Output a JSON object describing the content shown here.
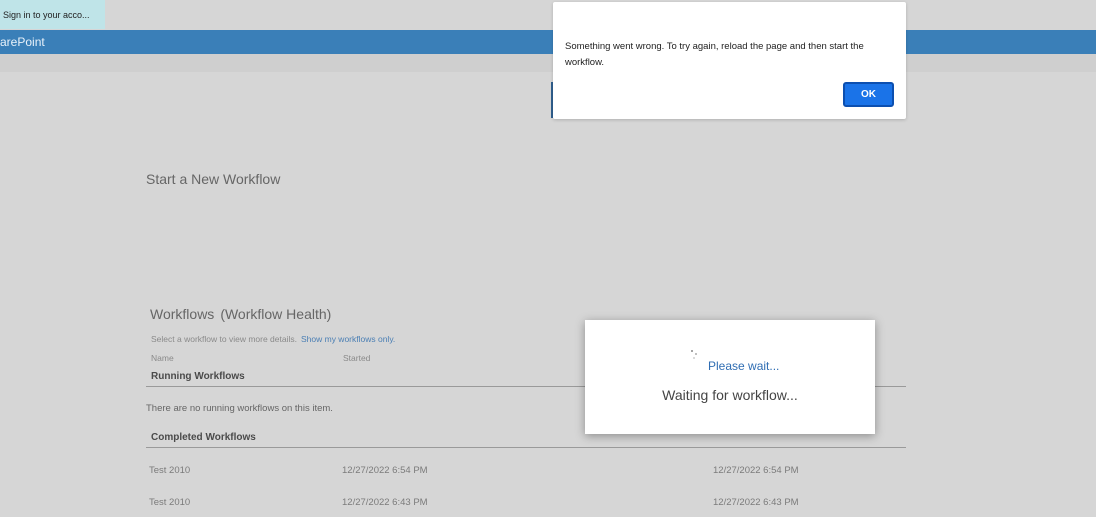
{
  "tab": {
    "label": "Sign in to your acco..."
  },
  "suitebar": {
    "title": "arePoint"
  },
  "alert": {
    "message": "Something went wrong. To try again, reload the page and then start the workflow.",
    "ok_label": "OK"
  },
  "start": {
    "title": "Start a New Workflow"
  },
  "workflows": {
    "title": "Workflows",
    "health_link": "(Workflow Health)",
    "hint": "Select a workflow to view more details.",
    "my_link": "Show my workflows only.",
    "columns": {
      "name": "Name",
      "started": "Started"
    },
    "running_heading": "Running Workflows",
    "running_empty": "There are no running workflows on this item.",
    "completed_heading": "Completed Workflows",
    "completed": [
      {
        "name": "Test 2010",
        "started": "12/27/2022 6:54 PM",
        "ended": "12/27/2022 6:54 PM"
      },
      {
        "name": "Test 2010",
        "started": "12/27/2022 6:43 PM",
        "ended": "12/27/2022 6:43 PM"
      }
    ]
  },
  "wait_dialog": {
    "title": "Please wait...",
    "message": "Waiting for workflow..."
  },
  "colors": {
    "suitebar": "#3a7fb8",
    "page_bg": "#d6d6d6",
    "ok_button": "#1a73e8",
    "link": "#4b7fb4"
  },
  "icons": {
    "spinner": "loading-spinner-icon"
  }
}
